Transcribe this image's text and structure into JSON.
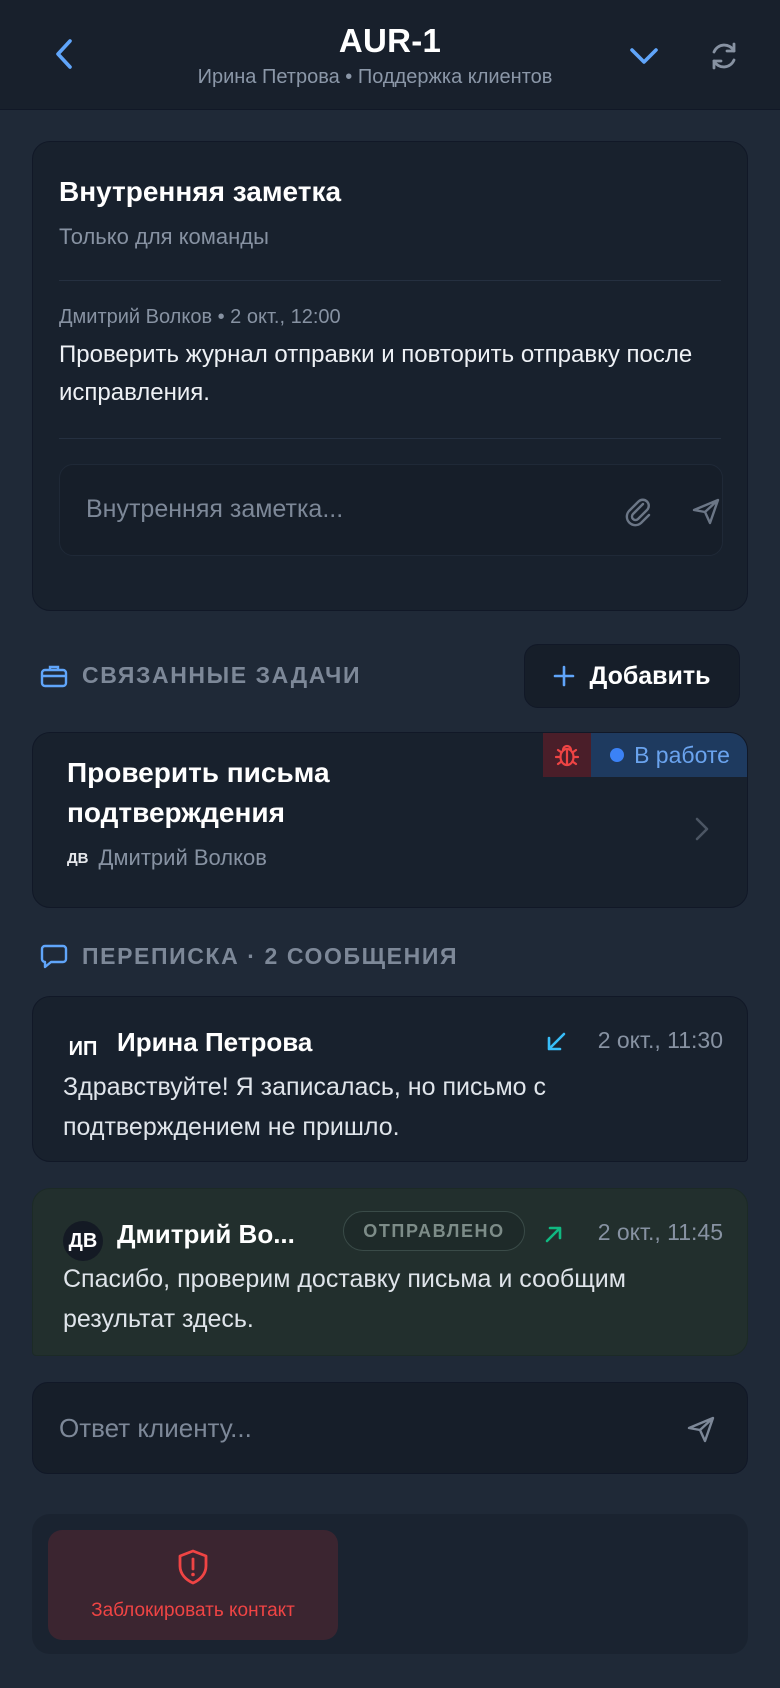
{
  "header": {
    "title": "AUR-1",
    "subtitle": "Ирина Петрова • Поддержка клиентов"
  },
  "note": {
    "title": "Внутренняя заметка",
    "subtitle": "Только для команды",
    "author_meta": "Дмитрий Волков • 2 окт., 12:00",
    "body": "Проверить журнал отправки и повторить отправку после исправления.",
    "input_placeholder": "Внутренняя заметка..."
  },
  "tasks": {
    "section_label": "СВЯЗАННЫЕ ЗАДАЧИ",
    "add_label": "Добавить",
    "items": [
      {
        "title": "Проверить письма подтверждения",
        "assignee_initials": "ДВ",
        "assignee": "Дмитрий Волков",
        "status": "В работе"
      }
    ]
  },
  "correspondence": {
    "section_label": "ПЕРЕПИСКА · 2 СООБЩЕНИЯ",
    "messages": [
      {
        "initials": "ИП",
        "author": "Ирина Петрова",
        "time": "2 окт., 11:30",
        "body": "Здравствуйте! Я записалась, но письмо с подтверждением не пришло."
      },
      {
        "initials": "ДВ",
        "author": "Дмитрий Во...",
        "badge": "ОТПРАВЛЕНО",
        "time": "2 окт., 11:45",
        "body": "Спасибо, проверим доставку письма и сообщим результат здесь."
      }
    ]
  },
  "reply": {
    "placeholder": "Ответ клиенту..."
  },
  "actions": {
    "block_label": "Заблокировать контакт"
  },
  "colors": {
    "background": "#1f2937",
    "card": "#18212d",
    "accent_blue": "#60a5fa",
    "status_blue": "#3b82f6",
    "danger": "#ef4444",
    "incoming_arrow": "#38bdf8",
    "outgoing_arrow": "#10b981"
  },
  "icons": {
    "back": "chevron-left-icon",
    "expand": "chevron-down-icon",
    "refresh": "refresh-icon",
    "attach": "paperclip-icon",
    "send": "send-icon",
    "tasks": "briefcase-icon",
    "chat": "chat-bubble-icon",
    "bug": "bug-icon",
    "block": "shield-alert-icon"
  }
}
